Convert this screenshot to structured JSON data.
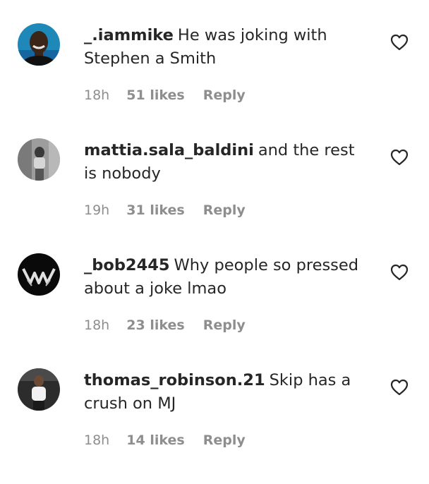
{
  "comments": [
    {
      "username": "_.iammike",
      "text": "He was joking with Stephen a Smith",
      "time": "18h",
      "likes": "51 likes",
      "reply": "Reply"
    },
    {
      "username": "mattia.sala_baldini",
      "text": "and the rest is nobody",
      "time": "19h",
      "likes": "31 likes",
      "reply": "Reply"
    },
    {
      "username": "_bob2445",
      "text": "Why people so pressed about a joke lmao",
      "time": "18h",
      "likes": "23 likes",
      "reply": "Reply"
    },
    {
      "username": "thomas_robinson.21",
      "text": "Skip has a crush on MJ",
      "time": "18h",
      "likes": "14 likes",
      "reply": "Reply"
    }
  ],
  "icons": {
    "like": "heart-outline-icon"
  },
  "colors": {
    "text": "#262626",
    "secondary": "#8e8e8e",
    "background": "#ffffff"
  }
}
